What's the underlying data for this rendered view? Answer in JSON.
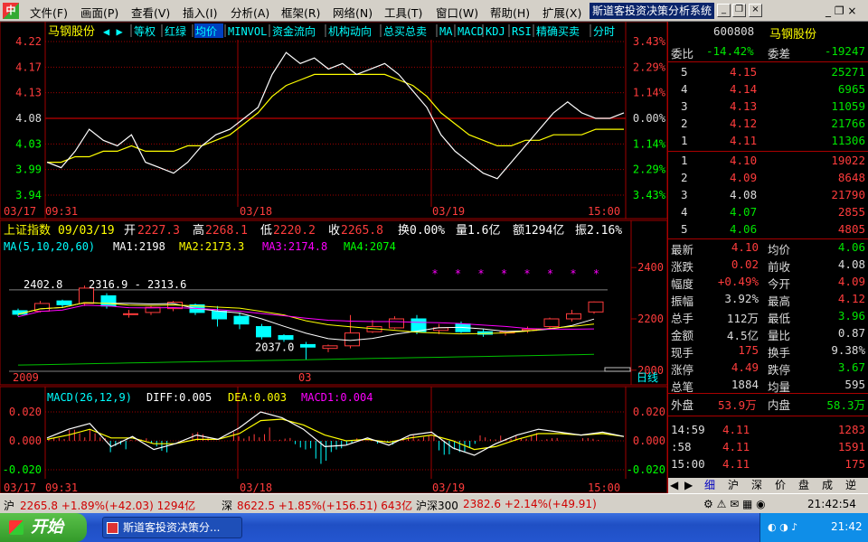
{
  "menubar": {
    "items": [
      "文件(F)",
      "画面(P)",
      "查看(V)",
      "插入(I)",
      "分析(A)",
      "框架(R)",
      "网络(N)",
      "工具(T)",
      "窗口(W)",
      "帮助(H)",
      "扩展(X)"
    ],
    "window_title": "斯道客投资决策分析系统"
  },
  "intraday": {
    "stock_name": "马钢股份",
    "tabs": [
      "等权",
      "红绿",
      "均价",
      "MINVOL",
      "资金流向",
      "机构动向",
      "总买总卖",
      "MA",
      "MACD",
      "KDJ",
      "RSI",
      "精确买卖",
      "分时"
    ],
    "active_tab": "均价",
    "price_ticks": [
      "4.22",
      "4.17",
      "4.13",
      "4.08",
      "4.03",
      "3.99",
      "3.94"
    ],
    "pct_ticks": [
      "3.43%",
      "2.29%",
      "1.14%",
      "0.00%",
      "1.14%",
      "2.29%",
      "3.43%"
    ],
    "time_labels": [
      "03/17",
      "09:31",
      "03/18",
      "03/19",
      "15:00"
    ]
  },
  "kline": {
    "header": {
      "name": "上证指数",
      "date": "09/03/19",
      "open_label": "开",
      "open": "2227.3",
      "high_label": "高",
      "high": "2268.1",
      "low_label": "低",
      "low": "2220.2",
      "close_label": "收",
      "close": "2265.8",
      "turnover": "换0.00%",
      "volume": "量1.6亿",
      "amount": "额1294亿",
      "amplitude": "振2.16%"
    },
    "ma": {
      "label": "MA(5,10,20,60)",
      "ma1": "MA1:2198",
      "ma2": "MA2:2173.3",
      "ma3": "MA3:2174.8",
      "ma4": "MA4:2074"
    },
    "annotations": {
      "hi": "2402.8",
      "range": "2316.9 - 2313.6",
      "lo": "2037.0"
    },
    "y_ticks": [
      "2400",
      "2200",
      "2000"
    ],
    "x_labels": [
      "2009",
      "03"
    ],
    "period": "日线"
  },
  "macd": {
    "header": "MACD(26,12,9)",
    "diff": "DIFF:0.005",
    "dea": "DEA:0.003",
    "macd1": "MACD1:0.004",
    "y_ticks": [
      "0.020",
      "0.000",
      "-0.020"
    ],
    "time_labels": [
      "03/17",
      "09:31",
      "03/18",
      "03/19",
      "15:00"
    ]
  },
  "quote": {
    "code": "600808",
    "name": "马钢股份",
    "weibi_label": "委比",
    "weibi": "-14.42%",
    "weicha_label": "委差",
    "weicha": "-19247",
    "sell": [
      {
        "lvl": "5",
        "price": "4.15",
        "vol": "25271"
      },
      {
        "lvl": "4",
        "price": "4.14",
        "vol": "6965"
      },
      {
        "lvl": "3",
        "price": "4.13",
        "vol": "11059"
      },
      {
        "lvl": "2",
        "price": "4.12",
        "vol": "21766"
      },
      {
        "lvl": "1",
        "price": "4.11",
        "vol": "11306"
      }
    ],
    "buy": [
      {
        "lvl": "1",
        "price": "4.10",
        "vol": "19022"
      },
      {
        "lvl": "2",
        "price": "4.09",
        "vol": "8648"
      },
      {
        "lvl": "3",
        "price": "4.08",
        "vol": "21790"
      },
      {
        "lvl": "4",
        "price": "4.07",
        "vol": "2855"
      },
      {
        "lvl": "5",
        "price": "4.06",
        "vol": "4805"
      }
    ],
    "stats": [
      {
        "l1": "最新",
        "v1": "4.10",
        "c1": "red",
        "l2": "均价",
        "v2": "4.06",
        "c2": "grn"
      },
      {
        "l1": "涨跌",
        "v1": "0.02",
        "c1": "red",
        "l2": "前收",
        "v2": "4.08",
        "c2": "wht"
      },
      {
        "l1": "幅度",
        "v1": "+0.49%",
        "c1": "red",
        "l2": "今开",
        "v2": "4.09",
        "c2": "red"
      },
      {
        "l1": "振幅",
        "v1": "3.92%",
        "c1": "wht",
        "l2": "最高",
        "v2": "4.12",
        "c2": "red"
      },
      {
        "l1": "总手",
        "v1": "112万",
        "c1": "wht",
        "l2": "最低",
        "v2": "3.96",
        "c2": "grn"
      },
      {
        "l1": "金额",
        "v1": "4.5亿",
        "c1": "wht",
        "l2": "量比",
        "v2": "0.87",
        "c2": "wht"
      },
      {
        "l1": "现手",
        "v1": "175",
        "c1": "red",
        "l2": "换手",
        "v2": "9.38%",
        "c2": "wht"
      },
      {
        "l1": "涨停",
        "v1": "4.49",
        "c1": "red",
        "l2": "跌停",
        "v2": "3.67",
        "c2": "grn"
      },
      {
        "l1": "总笔",
        "v1": "1884",
        "c1": "wht",
        "l2": "均量",
        "v2": "595",
        "c2": "wht"
      }
    ],
    "outer_label": "外盘",
    "outer": "53.9万",
    "inner_label": "内盘",
    "inner": "58.3万",
    "ticks": [
      {
        "t": "14:59",
        "p": "4.11",
        "v": "1283"
      },
      {
        "t": ":58",
        "p": "4.11",
        "v": "1591"
      },
      {
        "t": "15:00",
        "p": "4.11",
        "v": "175"
      }
    ],
    "tabs": [
      "细",
      "沪",
      "深",
      "价",
      "盘",
      "成",
      "逆"
    ]
  },
  "status": {
    "sh_label": "沪",
    "sh": "2265.8 +1.89%(+42.03) 1294亿",
    "sz_label": "深",
    "sz": "8622.5 +1.85%(+156.51) 643亿",
    "hs_label": "沪深300",
    "hs": "2382.6 +2.14%(+49.91)",
    "time": "21:42:54"
  },
  "taskbar": {
    "start": "开始",
    "item": "斯道客投资决策分...",
    "clock": "21:42"
  },
  "colors": {
    "up": "#ff3c3c",
    "down": "#00ffff",
    "ma1": "#ffffff",
    "ma2": "#ffff00",
    "ma3": "#ff00ff",
    "ma4": "#00c000",
    "grid": "#a00000"
  },
  "chart_data": [
    {
      "type": "line",
      "title": "马钢股份 分时",
      "series": [
        {
          "name": "price",
          "values": [
            4.0,
            3.99,
            4.02,
            4.06,
            4.04,
            4.03,
            4.05,
            4.0,
            3.99,
            3.98,
            4.0,
            4.03,
            4.05,
            4.06,
            4.08,
            4.1,
            4.16,
            4.2,
            4.18,
            4.19,
            4.17,
            4.18,
            4.16,
            4.17,
            4.18,
            4.16,
            4.13,
            4.1,
            4.05,
            4.02,
            4.0,
            3.98,
            3.97,
            4.0,
            4.03,
            4.06,
            4.09,
            4.11,
            4.09,
            4.08,
            4.08,
            4.09
          ]
        },
        {
          "name": "avg",
          "values": [
            4.0,
            4.0,
            4.01,
            4.01,
            4.02,
            4.02,
            4.03,
            4.02,
            4.02,
            4.02,
            4.03,
            4.03,
            4.04,
            4.05,
            4.07,
            4.09,
            4.12,
            4.14,
            4.15,
            4.16,
            4.16,
            4.16,
            4.16,
            4.16,
            4.16,
            4.15,
            4.14,
            4.12,
            4.09,
            4.07,
            4.05,
            4.04,
            4.03,
            4.03,
            4.04,
            4.04,
            4.05,
            4.05,
            4.05,
            4.06,
            4.06,
            4.06
          ]
        }
      ],
      "ylim": [
        3.94,
        4.22
      ]
    },
    {
      "type": "bar",
      "title": "上证指数 日线",
      "candles": [
        {
          "o": 2232,
          "c": 2218,
          "h": 2240,
          "l": 2210
        },
        {
          "o": 2230,
          "c": 2260,
          "h": 2270,
          "l": 2225
        },
        {
          "o": 2270,
          "c": 2255,
          "h": 2275,
          "l": 2245
        },
        {
          "o": 2260,
          "c": 2320,
          "h": 2330,
          "l": 2250
        },
        {
          "o": 2290,
          "c": 2250,
          "h": 2300,
          "l": 2240
        },
        {
          "o": 2220,
          "c": 2220,
          "h": 2235,
          "l": 2205
        },
        {
          "o": 2225,
          "c": 2245,
          "h": 2250,
          "l": 2215
        },
        {
          "o": 2240,
          "c": 2265,
          "h": 2270,
          "l": 2230
        },
        {
          "o": 2255,
          "c": 2225,
          "h": 2260,
          "l": 2215
        },
        {
          "o": 2230,
          "c": 2200,
          "h": 2250,
          "l": 2170
        },
        {
          "o": 2210,
          "c": 2180,
          "h": 2225,
          "l": 2160
        },
        {
          "o": 2170,
          "c": 2130,
          "h": 2180,
          "l": 2120
        },
        {
          "o": 2135,
          "c": 2120,
          "h": 2140,
          "l": 2110
        },
        {
          "o": 2100,
          "c": 2090,
          "h": 2110,
          "l": 2040
        },
        {
          "o": 2085,
          "c": 2095,
          "h": 2100,
          "l": 2070
        },
        {
          "o": 2095,
          "c": 2145,
          "h": 2215,
          "l": 2085
        },
        {
          "o": 2150,
          "c": 2170,
          "h": 2195,
          "l": 2145
        },
        {
          "o": 2165,
          "c": 2200,
          "h": 2210,
          "l": 2160
        },
        {
          "o": 2200,
          "c": 2150,
          "h": 2215,
          "l": 2140
        },
        {
          "o": 2155,
          "c": 2165,
          "h": 2180,
          "l": 2140
        },
        {
          "o": 2180,
          "c": 2150,
          "h": 2190,
          "l": 2145
        },
        {
          "o": 2150,
          "c": 2140,
          "h": 2160,
          "l": 2130
        },
        {
          "o": 2145,
          "c": 2150,
          "h": 2155,
          "l": 2135
        },
        {
          "o": 2155,
          "c": 2160,
          "h": 2170,
          "l": 2145
        },
        {
          "o": 2170,
          "c": 2200,
          "h": 2205,
          "l": 2160
        },
        {
          "o": 2200,
          "c": 2220,
          "h": 2235,
          "l": 2190
        },
        {
          "o": 2227,
          "c": 2266,
          "h": 2268,
          "l": 2220
        }
      ],
      "ylim": [
        1950,
        2450
      ]
    },
    {
      "type": "line",
      "title": "MACD",
      "series": [
        {
          "name": "DIFF",
          "values": [
            0.002,
            0.008,
            0.012,
            -0.004,
            0.003,
            -0.006,
            -0.002,
            0.004,
            0.001,
            0.009,
            0.02,
            0.016,
            0.008,
            -0.004,
            -0.003,
            0.002,
            -0.003,
            0.004,
            0.006,
            -0.005,
            -0.01,
            -0.002,
            0.004,
            0.008,
            0.006,
            0.004,
            0.006,
            0.003
          ]
        },
        {
          "name": "DEA",
          "values": [
            0.001,
            0.004,
            0.008,
            0.002,
            0.002,
            -0.002,
            -0.002,
            0.001,
            0.001,
            0.005,
            0.014,
            0.015,
            0.011,
            0.004,
            0.0,
            0.001,
            -0.001,
            0.002,
            0.004,
            0.0,
            -0.006,
            -0.004,
            0.001,
            0.005,
            0.005,
            0.004,
            0.005,
            0.003
          ]
        }
      ],
      "ylim": [
        -0.025,
        0.025
      ]
    }
  ]
}
